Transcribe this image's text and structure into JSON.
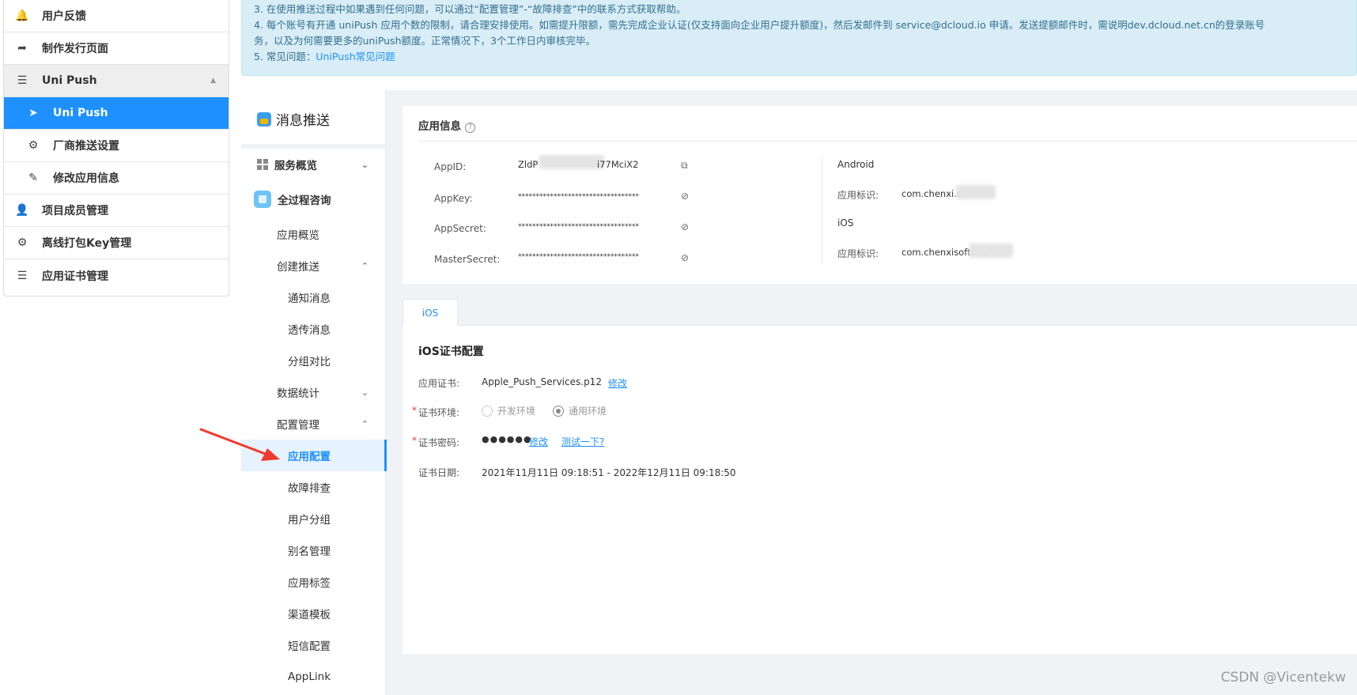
{
  "left_nav": {
    "items": [
      {
        "label": "用户反馈",
        "icon": "bell-icon"
      },
      {
        "label": "制作发行页面",
        "icon": "share-arrow-icon"
      },
      {
        "label": "Uni Push",
        "icon": "menu-icon"
      },
      {
        "label": "Uni Push",
        "icon": "send-icon"
      },
      {
        "label": "厂商推送设置",
        "icon": "gear-icon"
      },
      {
        "label": "修改应用信息",
        "icon": "edit-icon"
      },
      {
        "label": "项目成员管理",
        "icon": "user-icon"
      },
      {
        "label": "离线打包Key管理",
        "icon": "gear-icon"
      },
      {
        "label": "应用证书管理",
        "icon": "list-icon"
      }
    ]
  },
  "banner": {
    "line3": "3. 在使用推送过程中如果遇到任何问题，可以通过“配置管理”-“故障排查”中的联系方式获取帮助。",
    "line4": "4. 每个账号有开通 uniPush 应用个数的限制，请合理安排使用。如需提升限额，需先完成企业认证(仅支持面向企业用户提升额度)，然后发邮件到 service@dcloud.io 申请。发送提额邮件时，需说明dev.dcloud.net.cn的登录账号",
    "line4b": "务，以及为何需要更多的uniPush额度。正常情况下，3个工作日内审核完毕。",
    "line5_prefix": "5. 常见问题：",
    "line5_link": "UniPush常见问题"
  },
  "sub_nav": {
    "title": "消息推送",
    "items": {
      "service_overview": "服务概览",
      "full_consult": "全过程咨询",
      "app_overview": "应用概览",
      "create_push": "创建推送",
      "notify_msg": "通知消息",
      "passthrough_msg": "透传消息",
      "group_compare": "分组对比",
      "data_stats": "数据统计",
      "config_mgmt": "配置管理",
      "app_config": "应用配置",
      "troubleshoot": "故障排查",
      "user_group": "用户分组",
      "alias_mgmt": "别名管理",
      "app_tags": "应用标签",
      "channel_template": "渠道模板",
      "sms_config": "短信配置",
      "applink": "AppLink"
    }
  },
  "app_info": {
    "title": "应用信息",
    "help": "?",
    "appid_label": "AppID:",
    "appid_prefix": "ZldP",
    "appid_suffix": "i77MciX2",
    "appkey_label": "AppKey:",
    "appsecret_label": "AppSecret:",
    "mastersecret_label": "MasterSecret:",
    "masked": "**********************************",
    "android_title": "Android",
    "android_id_label": "应用标识:",
    "android_id_value": "com.chenxi.ur",
    "ios_title": "iOS",
    "ios_id_label": "应用标识:",
    "ios_id_value": "com.chenxisoft.UN"
  },
  "tabs": {
    "ios": "iOS"
  },
  "cert": {
    "title": "iOS证书配置",
    "cert_label": "应用证书:",
    "cert_file": "Apple_Push_Services.p12",
    "modify": "修改",
    "env_label": "证书环境:",
    "env_dev": "开发环境",
    "env_general": "通用环境",
    "env_selected": "通用环境",
    "pwd_label": "证书密码:",
    "pwd_value": "●●●●●●",
    "pwd_modify": "修改",
    "pwd_test": "测试一下?",
    "date_label": "证书日期:",
    "date_value": "2021年11月11日 09:18:51 - 2022年12月11日 09:18:50"
  },
  "watermark": "CSDN @Vicentekw",
  "colors": {
    "accent": "#1e90ff",
    "banner_bg": "#d9edf7",
    "arrow": "#f03a2e"
  }
}
